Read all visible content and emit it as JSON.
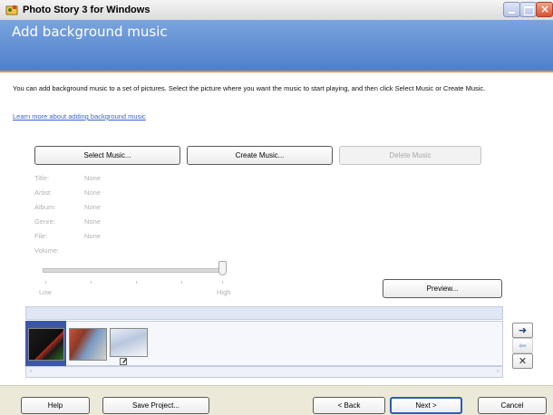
{
  "window": {
    "title": "Photo Story 3 for Windows"
  },
  "header": {
    "title": "Add background music"
  },
  "intro": {
    "text": "You can add background music to a set of pictures.  Select the picture where you want the music to start playing, and then click Select Music or Create Music.",
    "link": "Learn more about adding background music"
  },
  "music_buttons": {
    "select": "Select Music...",
    "create": "Create Music...",
    "delete": "Delete Music"
  },
  "metadata": [
    {
      "label": "Title:",
      "value": "None"
    },
    {
      "label": "Artist:",
      "value": "None"
    },
    {
      "label": "Album:",
      "value": "None"
    },
    {
      "label": "Genre:",
      "value": "None"
    },
    {
      "label": "File:",
      "value": "None"
    },
    {
      "label": "Volume:",
      "value": ""
    }
  ],
  "volume": {
    "low_label": "Low",
    "high_label": "High",
    "level": 1.0
  },
  "preview": {
    "label": "Preview..."
  },
  "bottom_buttons": {
    "help": "Help",
    "save": "Save Project...",
    "back": "< Back",
    "next": "Next >",
    "cancel": "Cancel"
  },
  "colors": {
    "header": "#5b8ad4",
    "header_border": "#e7963a",
    "link": "#3d63c8"
  },
  "icons": {
    "move_right": "arrow-right-icon",
    "move_left": "arrow-left-icon",
    "remove": "x-icon"
  }
}
